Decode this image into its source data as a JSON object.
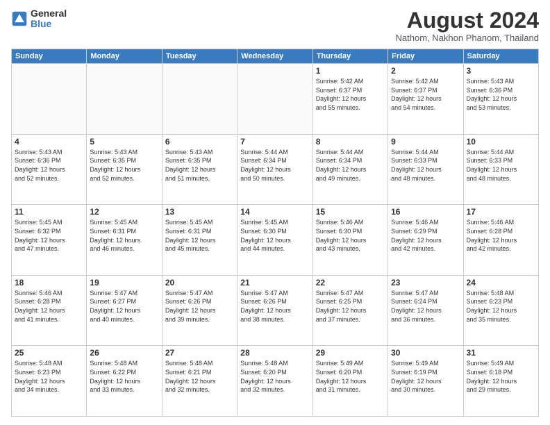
{
  "logo": {
    "general": "General",
    "blue": "Blue"
  },
  "title": "August 2024",
  "location": "Nathom, Nakhon Phanom, Thailand",
  "days_of_week": [
    "Sunday",
    "Monday",
    "Tuesday",
    "Wednesday",
    "Thursday",
    "Friday",
    "Saturday"
  ],
  "weeks": [
    [
      {
        "day": "",
        "info": ""
      },
      {
        "day": "",
        "info": ""
      },
      {
        "day": "",
        "info": ""
      },
      {
        "day": "",
        "info": ""
      },
      {
        "day": "1",
        "info": "Sunrise: 5:42 AM\nSunset: 6:37 PM\nDaylight: 12 hours\nand 55 minutes."
      },
      {
        "day": "2",
        "info": "Sunrise: 5:42 AM\nSunset: 6:37 PM\nDaylight: 12 hours\nand 54 minutes."
      },
      {
        "day": "3",
        "info": "Sunrise: 5:43 AM\nSunset: 6:36 PM\nDaylight: 12 hours\nand 53 minutes."
      }
    ],
    [
      {
        "day": "4",
        "info": "Sunrise: 5:43 AM\nSunset: 6:36 PM\nDaylight: 12 hours\nand 52 minutes."
      },
      {
        "day": "5",
        "info": "Sunrise: 5:43 AM\nSunset: 6:35 PM\nDaylight: 12 hours\nand 52 minutes."
      },
      {
        "day": "6",
        "info": "Sunrise: 5:43 AM\nSunset: 6:35 PM\nDaylight: 12 hours\nand 51 minutes."
      },
      {
        "day": "7",
        "info": "Sunrise: 5:44 AM\nSunset: 6:34 PM\nDaylight: 12 hours\nand 50 minutes."
      },
      {
        "day": "8",
        "info": "Sunrise: 5:44 AM\nSunset: 6:34 PM\nDaylight: 12 hours\nand 49 minutes."
      },
      {
        "day": "9",
        "info": "Sunrise: 5:44 AM\nSunset: 6:33 PM\nDaylight: 12 hours\nand 48 minutes."
      },
      {
        "day": "10",
        "info": "Sunrise: 5:44 AM\nSunset: 6:33 PM\nDaylight: 12 hours\nand 48 minutes."
      }
    ],
    [
      {
        "day": "11",
        "info": "Sunrise: 5:45 AM\nSunset: 6:32 PM\nDaylight: 12 hours\nand 47 minutes."
      },
      {
        "day": "12",
        "info": "Sunrise: 5:45 AM\nSunset: 6:31 PM\nDaylight: 12 hours\nand 46 minutes."
      },
      {
        "day": "13",
        "info": "Sunrise: 5:45 AM\nSunset: 6:31 PM\nDaylight: 12 hours\nand 45 minutes."
      },
      {
        "day": "14",
        "info": "Sunrise: 5:45 AM\nSunset: 6:30 PM\nDaylight: 12 hours\nand 44 minutes."
      },
      {
        "day": "15",
        "info": "Sunrise: 5:46 AM\nSunset: 6:30 PM\nDaylight: 12 hours\nand 43 minutes."
      },
      {
        "day": "16",
        "info": "Sunrise: 5:46 AM\nSunset: 6:29 PM\nDaylight: 12 hours\nand 42 minutes."
      },
      {
        "day": "17",
        "info": "Sunrise: 5:46 AM\nSunset: 6:28 PM\nDaylight: 12 hours\nand 42 minutes."
      }
    ],
    [
      {
        "day": "18",
        "info": "Sunrise: 5:46 AM\nSunset: 6:28 PM\nDaylight: 12 hours\nand 41 minutes."
      },
      {
        "day": "19",
        "info": "Sunrise: 5:47 AM\nSunset: 6:27 PM\nDaylight: 12 hours\nand 40 minutes."
      },
      {
        "day": "20",
        "info": "Sunrise: 5:47 AM\nSunset: 6:26 PM\nDaylight: 12 hours\nand 39 minutes."
      },
      {
        "day": "21",
        "info": "Sunrise: 5:47 AM\nSunset: 6:26 PM\nDaylight: 12 hours\nand 38 minutes."
      },
      {
        "day": "22",
        "info": "Sunrise: 5:47 AM\nSunset: 6:25 PM\nDaylight: 12 hours\nand 37 minutes."
      },
      {
        "day": "23",
        "info": "Sunrise: 5:47 AM\nSunset: 6:24 PM\nDaylight: 12 hours\nand 36 minutes."
      },
      {
        "day": "24",
        "info": "Sunrise: 5:48 AM\nSunset: 6:23 PM\nDaylight: 12 hours\nand 35 minutes."
      }
    ],
    [
      {
        "day": "25",
        "info": "Sunrise: 5:48 AM\nSunset: 6:23 PM\nDaylight: 12 hours\nand 34 minutes."
      },
      {
        "day": "26",
        "info": "Sunrise: 5:48 AM\nSunset: 6:22 PM\nDaylight: 12 hours\nand 33 minutes."
      },
      {
        "day": "27",
        "info": "Sunrise: 5:48 AM\nSunset: 6:21 PM\nDaylight: 12 hours\nand 32 minutes."
      },
      {
        "day": "28",
        "info": "Sunrise: 5:48 AM\nSunset: 6:20 PM\nDaylight: 12 hours\nand 32 minutes."
      },
      {
        "day": "29",
        "info": "Sunrise: 5:49 AM\nSunset: 6:20 PM\nDaylight: 12 hours\nand 31 minutes."
      },
      {
        "day": "30",
        "info": "Sunrise: 5:49 AM\nSunset: 6:19 PM\nDaylight: 12 hours\nand 30 minutes."
      },
      {
        "day": "31",
        "info": "Sunrise: 5:49 AM\nSunset: 6:18 PM\nDaylight: 12 hours\nand 29 minutes."
      }
    ]
  ]
}
